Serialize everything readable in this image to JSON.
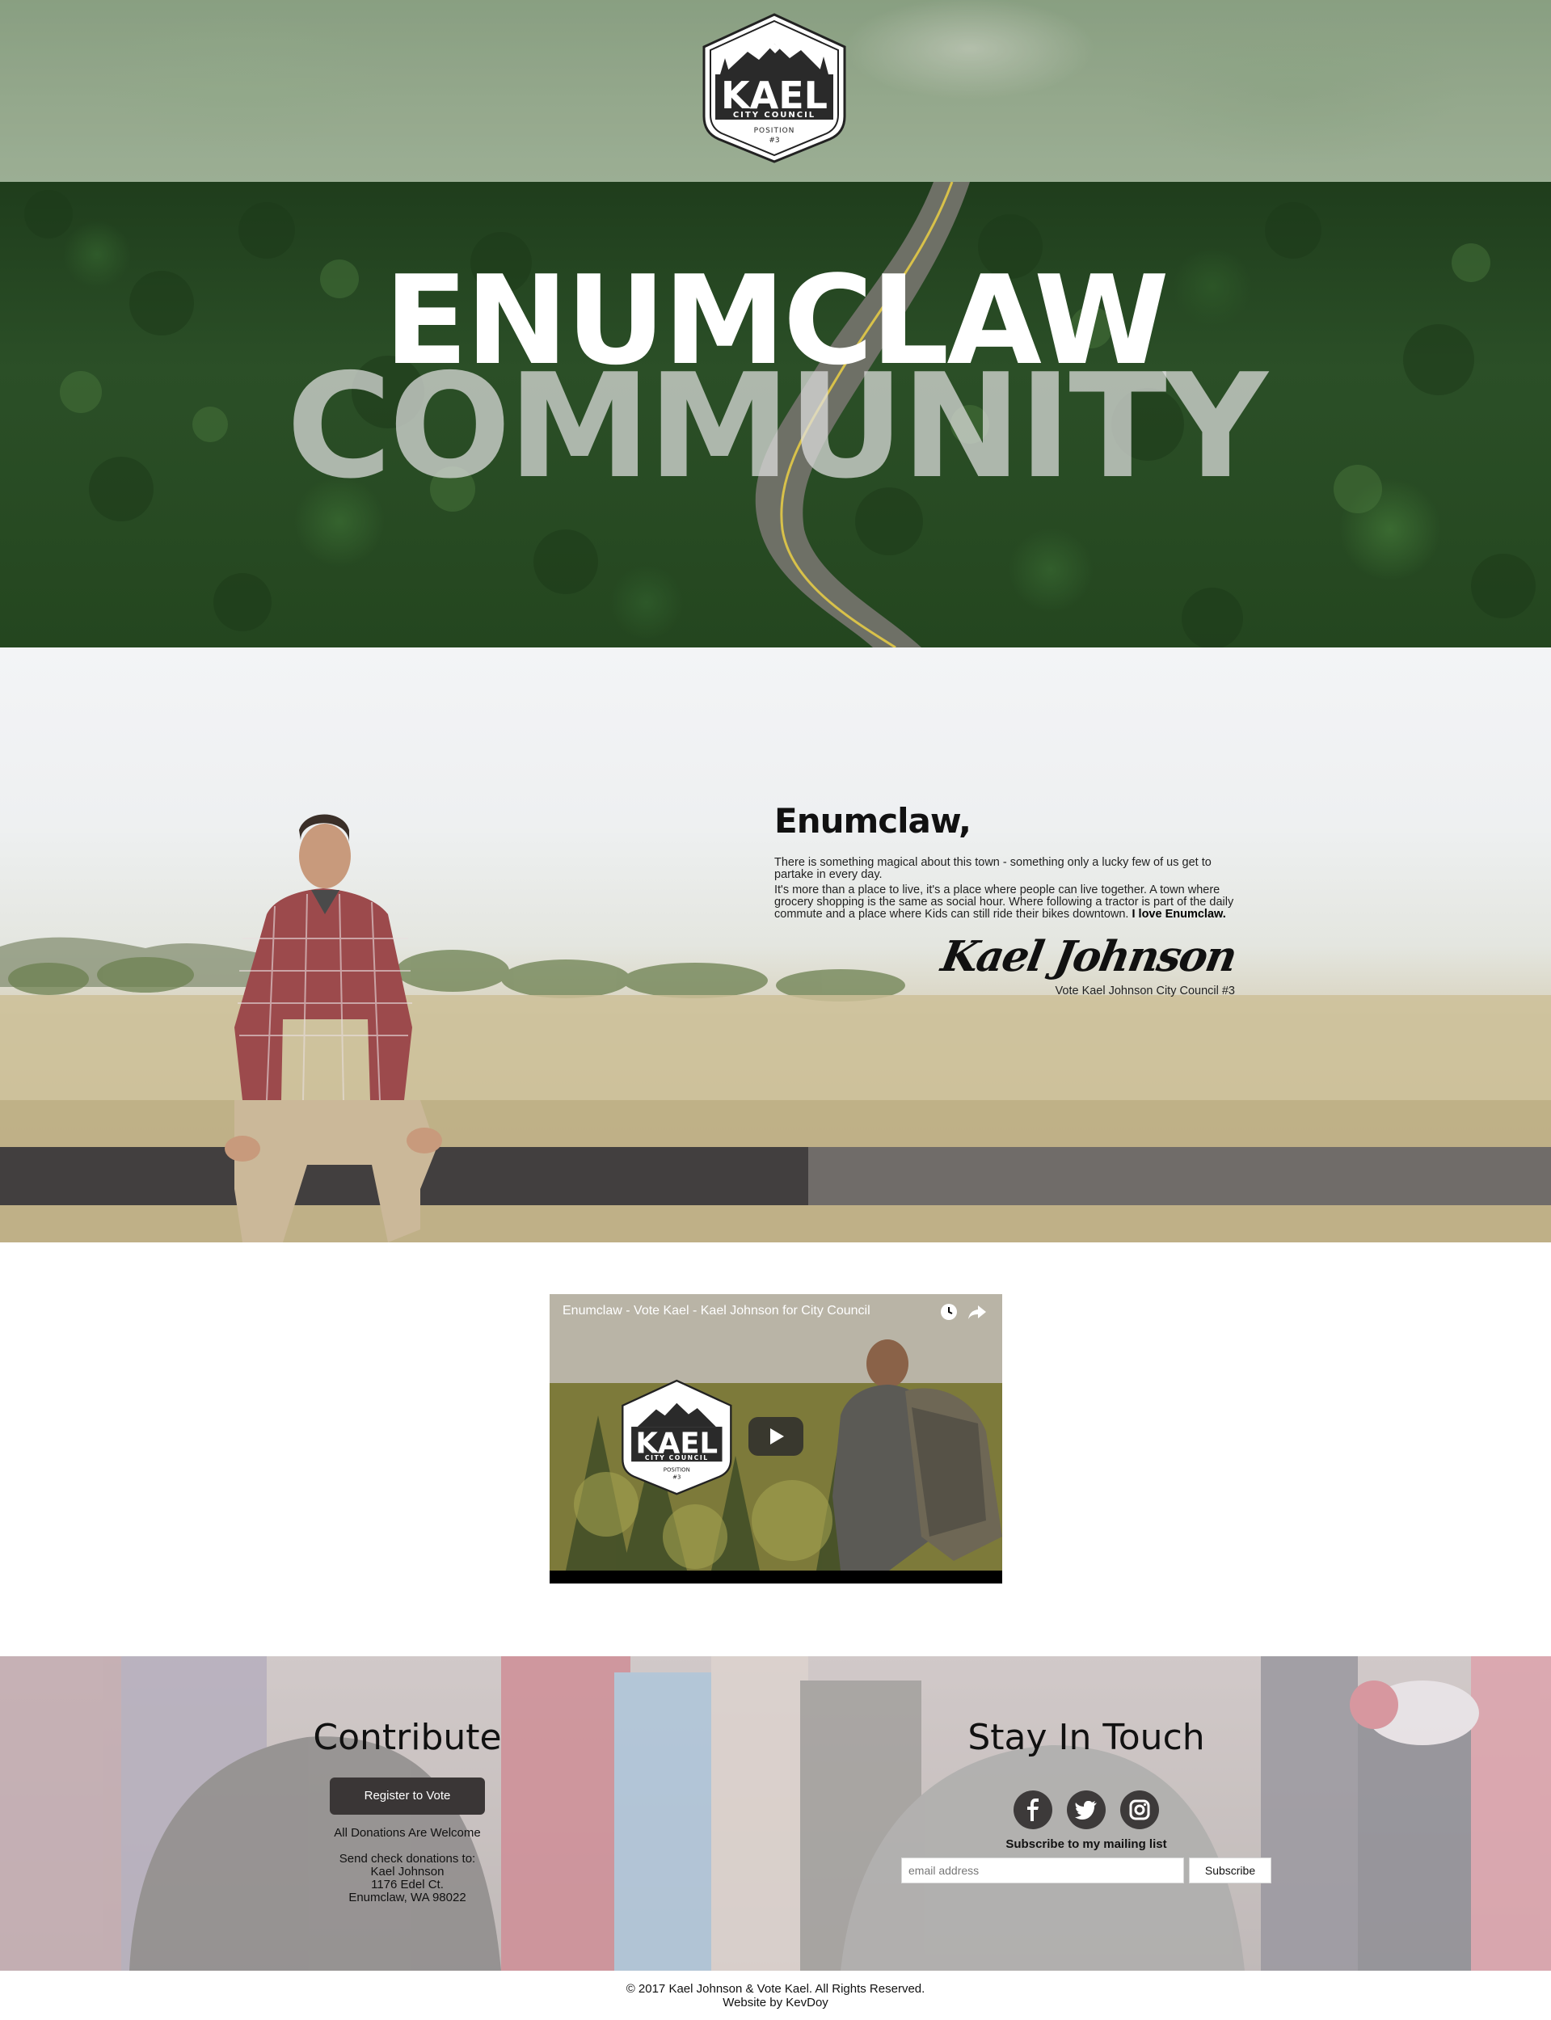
{
  "brand": {
    "logo_name": "KAEL",
    "logo_sub": "CITY COUNCIL",
    "logo_position": "POSITION",
    "logo_number": "#3"
  },
  "hero": {
    "line1": "ENUMCLAW",
    "line2": "COMMUNITY"
  },
  "about": {
    "title": "Enumclaw,",
    "paragraph1": "There is something magical about this town - something only a lucky few of us get to partake in every day.",
    "paragraph2": "It's more than a place to live, it's a place where people can live together. A town where grocery shopping is the same as social hour. Where following a tractor is part of the daily commute and a place where Kids can still ride their bikes downtown.",
    "paragraph2_bold": "I love Enumclaw.",
    "signature": "Kael Johnson",
    "signature_caption": "Vote Kael Johnson City Council #3"
  },
  "video": {
    "title": "Enumclaw - Vote Kael - Kael Johnson for City Council",
    "logo_name": "KAEL",
    "logo_sub": "CITY COUNCIL",
    "logo_position": "POSITION",
    "logo_number": "#3"
  },
  "contribute": {
    "heading": "Contribute",
    "button": "Register to Vote",
    "donations": "All Donations Are Welcome",
    "address_lines": [
      "Send check donations to:",
      "Kael Johnson",
      "1176 Edel Ct.",
      "Enumclaw, WA 98022"
    ]
  },
  "stay_in_touch": {
    "heading": "Stay In Touch",
    "socials": [
      "facebook-icon",
      "twitter-icon",
      "instagram-icon"
    ],
    "subscribe_label": "Subscribe to my mailing list",
    "email_placeholder": "email address",
    "subscribe_button": "Subscribe"
  },
  "footer": {
    "copyright": "© 2017 Kael Johnson & Vote Kael. All Rights Reserved.",
    "credit": "Website by KevDoy"
  },
  "colors": {
    "button_dark": "#3a3636",
    "social_dark": "#3d3a3a",
    "forest": "#2b4f27"
  }
}
